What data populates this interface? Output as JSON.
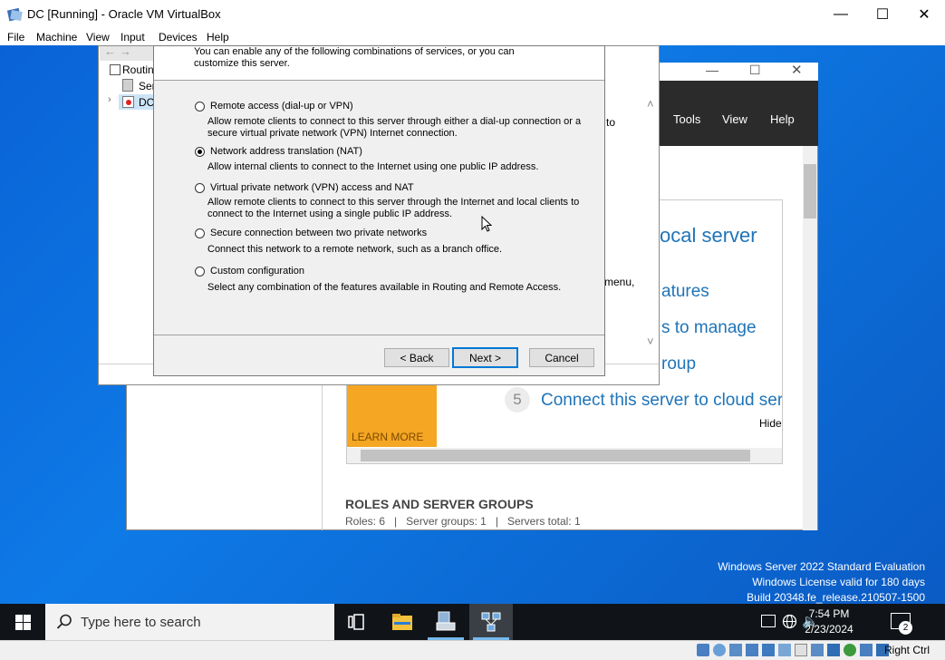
{
  "vbox": {
    "title": "DC [Running] - Oracle VM VirtualBox",
    "menu": [
      "File",
      "Machine",
      "View",
      "Input",
      "Devices",
      "Help"
    ],
    "host_key": "Right Ctrl"
  },
  "server_manager": {
    "toolbar": [
      "Tools",
      "View",
      "Help"
    ],
    "tile_local": "ocal server",
    "tile_features": "atures",
    "tile_manage": "s to manage",
    "tile_group": "roup",
    "tile5_num": "5",
    "tile5_text": "Connect this server to cloud servic",
    "hide": "Hide",
    "learn_more": "LEARN MORE",
    "partial_to": "to",
    "partial_menu": "menu,",
    "roles_title": "ROLES AND SERVER GROUPS",
    "roles_stats": "Roles: 6   |   Server groups: 1   |   Servers total: 1"
  },
  "rras": {
    "tree": [
      "Routin",
      "Ser",
      "DC"
    ]
  },
  "wizard": {
    "intro": "You can enable any of the following combinations of services, or you can customize this server.",
    "intro_line1": "You can enable any of the following combinations of services, or you can",
    "intro_line2": "customize this server.",
    "options": [
      {
        "label": "Remote access (dial-up or VPN)",
        "desc1": "Allow remote clients to connect to this server through either a dial-up connection or a",
        "desc2": "secure virtual private network (VPN) Internet connection.",
        "selected": false
      },
      {
        "label": "Network address translation (NAT)",
        "desc1": "Allow internal clients to connect to the Internet using one public IP address.",
        "desc2": "",
        "selected": true
      },
      {
        "label": "Virtual private network (VPN) access and NAT",
        "desc1": "Allow remote clients to connect to this server through the Internet and local clients to",
        "desc2": "connect to the Internet using a single public IP address.",
        "selected": false
      },
      {
        "label": "Secure connection between two private networks",
        "desc1": "Connect this network to a remote network, such as a branch office.",
        "desc2": "",
        "selected": false
      },
      {
        "label": "Custom configuration",
        "desc1": "Select any combination of the features available in Routing and Remote Access.",
        "desc2": "",
        "selected": false
      }
    ],
    "back": "< Back",
    "next": "Next >",
    "cancel": "Cancel"
  },
  "watermark": {
    "line1": "Windows Server 2022 Standard Evaluation",
    "line2": "Windows License valid for 180 days",
    "line3": "Build 20348.fe_release.210507-1500"
  },
  "taskbar": {
    "search_placeholder": "Type here to search",
    "time": "7:54 PM",
    "date": "2/23/2024",
    "notification_count": "2"
  },
  "colors": {
    "accent": "#0078d7",
    "desktop": "#0e7ae6",
    "sm_toolbar": "#2b2b2b",
    "learn_more": "#f5a623"
  }
}
